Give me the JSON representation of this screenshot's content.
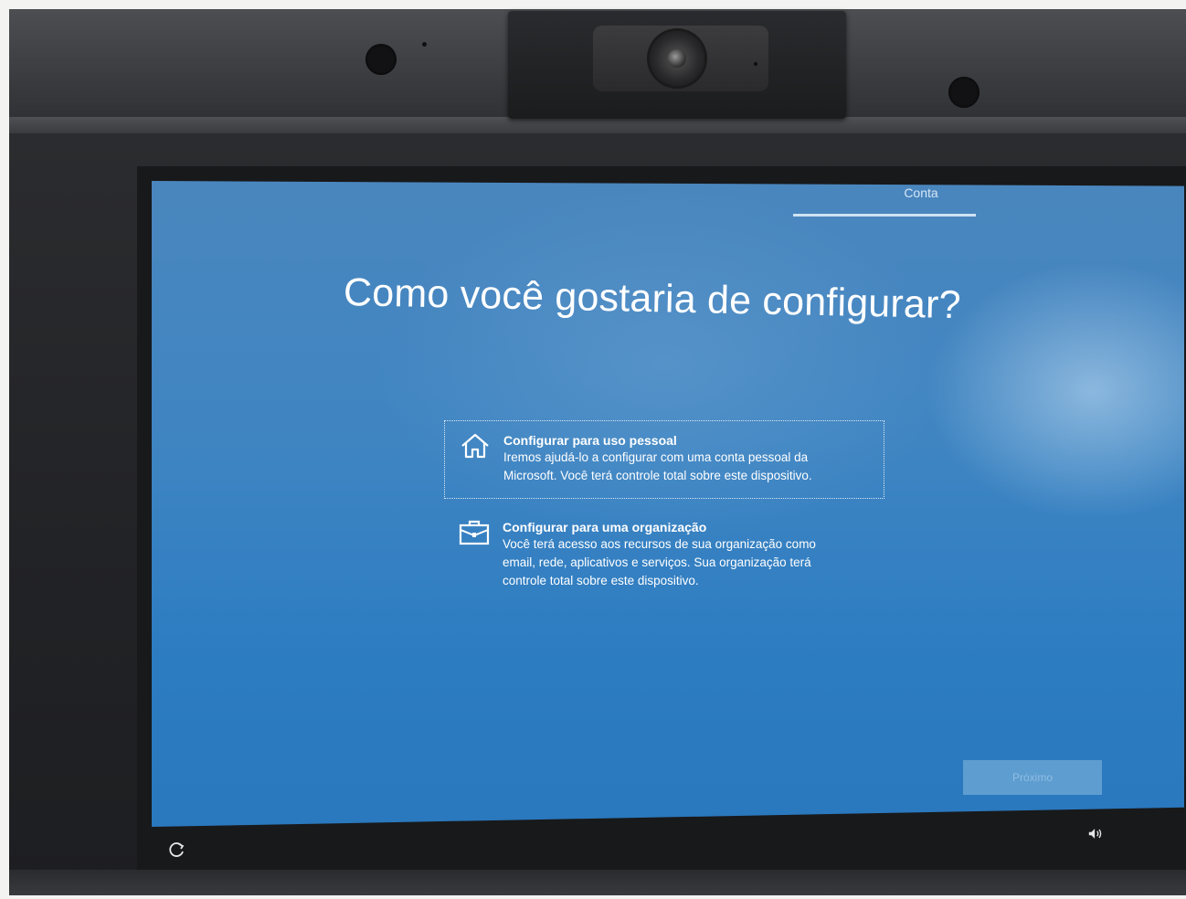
{
  "header": {
    "active_step": "Conta"
  },
  "main": {
    "title": "Como você gostaria de configurar?",
    "options": [
      {
        "title": "Configurar para uso pessoal",
        "description": "Iremos ajudá-lo a configurar com uma conta pessoal da Microsoft. Você terá controle total sobre este dispositivo.",
        "icon": "home-icon",
        "selected": true
      },
      {
        "title": "Configurar para uma organização",
        "description": "Você terá acesso aos recursos de sua organização como email, rede, aplicativos e serviços. Sua organização terá controle total sobre este dispositivo.",
        "icon": "briefcase-icon",
        "selected": false
      }
    ]
  },
  "footer": {
    "next_label": "Próximo",
    "accessibility_icon": "accessibility-icon",
    "volume_icon": "volume-icon"
  },
  "colors": {
    "screen_blue": "#2c7cc2",
    "text": "#ffffff",
    "bezel": "#222326"
  }
}
